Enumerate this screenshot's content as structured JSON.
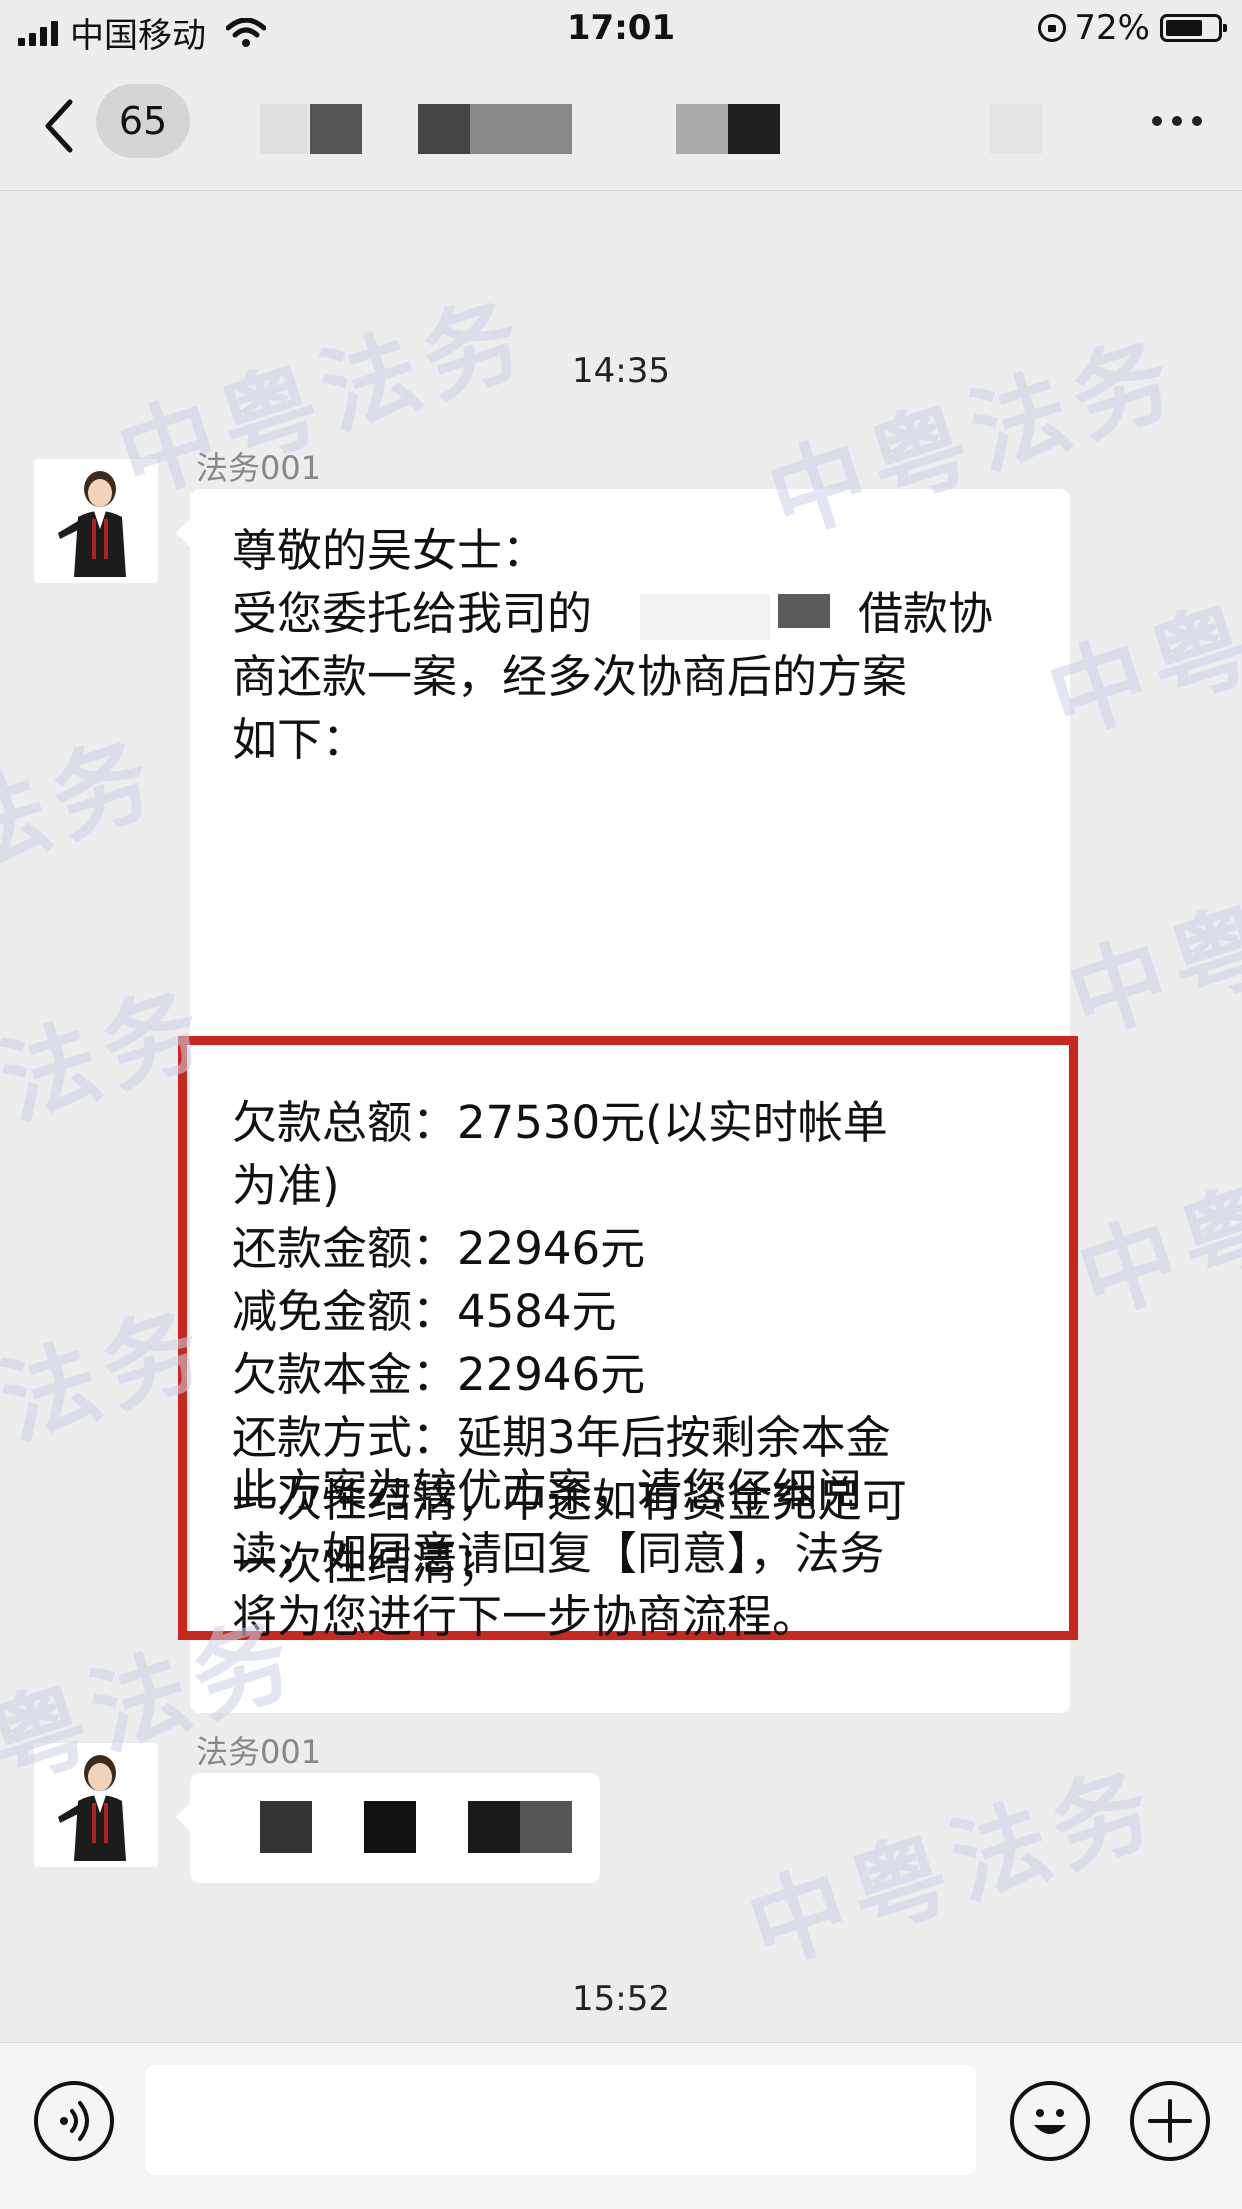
{
  "status_bar": {
    "carrier": "中国移动",
    "time": "17:01",
    "battery_percent": "72%",
    "battery_level": 0.72
  },
  "nav": {
    "unread_count": "65"
  },
  "chat": {
    "messages": [
      {
        "timestamp": "14:35",
        "sender": "法务001",
        "intro_lines": [
          "尊敬的吴女士：",
          "受您委托给我司的",
          "借款协",
          "商还款一案，经多次协商后的方案",
          "如下："
        ],
        "plan_lines": [
          "欠款总额：27530元(以实时帐单",
          "为准)",
          "还款金额：22946元",
          "减免金额：4584元",
          "欠款本金：22946元",
          "还款方式：延期3年后按剩余本金",
          "一次性结清，中途如有资金充足可",
          "一次性结清；"
        ],
        "outro_lines": [
          "此方案为较优方案，请您仔细阅",
          "读，如同意请回复【同意】，法务",
          "将为您进行下一步协商流程。"
        ]
      },
      {
        "sender": "法务001"
      },
      {
        "timestamp": "15:52"
      }
    ]
  },
  "watermark_text": "中粤法务",
  "colors": {
    "highlight_border": "#c8281e",
    "background": "#ededed",
    "bubble": "#ffffff"
  },
  "icons": {
    "back": "chevron-left-icon",
    "more": "more-dots-icon",
    "voice": "voice-icon",
    "emoji": "emoji-icon",
    "plus": "plus-icon"
  }
}
